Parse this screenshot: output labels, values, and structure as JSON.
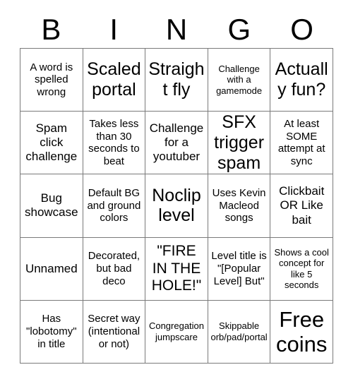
{
  "card": {
    "title": "BINGO",
    "header_letters": [
      "B",
      "I",
      "N",
      "G",
      "O"
    ],
    "grid_size": 5,
    "border_color": "#7a7a7a",
    "text_color": "#000000",
    "background_color": "#ffffff",
    "rows": [
      [
        {
          "text": "A word is spelled wrong",
          "size": "sm"
        },
        {
          "text": "Scaled portal",
          "size": "xl"
        },
        {
          "text": "Straight fly",
          "size": "xl"
        },
        {
          "text": "Challenge with a gamemode",
          "size": "xs"
        },
        {
          "text": "Actually fun?",
          "size": "xl"
        }
      ],
      [
        {
          "text": "Spam click challenge",
          "size": "md"
        },
        {
          "text": "Takes less than 30 seconds to beat",
          "size": "sm"
        },
        {
          "text": "Challenge for a youtuber",
          "size": "md"
        },
        {
          "text": "SFX trigger spam",
          "size": "xl"
        },
        {
          "text": "At least SOME attempt at sync",
          "size": "sm"
        }
      ],
      [
        {
          "text": "Bug showcase",
          "size": "md"
        },
        {
          "text": "Default BG and ground colors",
          "size": "sm"
        },
        {
          "text": "Noclip level",
          "size": "xl"
        },
        {
          "text": "Uses Kevin Macleod songs",
          "size": "sm"
        },
        {
          "text": "Clickbait OR Like bait",
          "size": "md"
        }
      ],
      [
        {
          "text": "Unnamed",
          "size": "md"
        },
        {
          "text": "Decorated, but bad deco",
          "size": "sm"
        },
        {
          "text": "\"FIRE IN THE HOLE!\"",
          "size": "lg"
        },
        {
          "text": "Level title is \"[Popular Level] But\"",
          "size": "sm"
        },
        {
          "text": "Shows a cool concept for like 5 seconds",
          "size": "xs"
        }
      ],
      [
        {
          "text": "Has \"lobotomy\" in title",
          "size": "sm"
        },
        {
          "text": "Secret way (intentional or not)",
          "size": "sm"
        },
        {
          "text": "Congregation jumpscare",
          "size": "xs"
        },
        {
          "text": "Skippable orb/pad/portal",
          "size": "xs"
        },
        {
          "text": "Free coins",
          "size": "xxl"
        }
      ]
    ]
  }
}
